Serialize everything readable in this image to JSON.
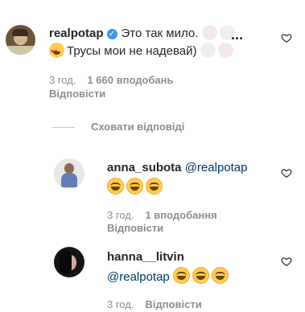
{
  "comments": [
    {
      "username": "realpotap",
      "verified": true,
      "text_line1": "Это так мило.",
      "text_line2": "Трусы мои не надевай)",
      "time": "3 год.",
      "likes": "1 660 вподобань",
      "reply_label": "Відповісти"
    }
  ],
  "hide_replies_label": "Сховати відповіді",
  "replies": [
    {
      "username": "anna_subota",
      "mention": "@realpotap",
      "time": "3 год.",
      "likes": "1 вподобання",
      "reply_label": "Відповісти"
    },
    {
      "username": "hanna__litvin",
      "mention": "@realpotap",
      "time": "3 год.",
      "reply_label": "Відповісти"
    }
  ],
  "icons": {
    "like": "heart-outline-icon",
    "verified": "verified-badge-icon",
    "more": "more-dots-icon"
  },
  "colors": {
    "mention": "#00376b",
    "verified": "#3897f0",
    "meta": "#8e8e8e"
  }
}
